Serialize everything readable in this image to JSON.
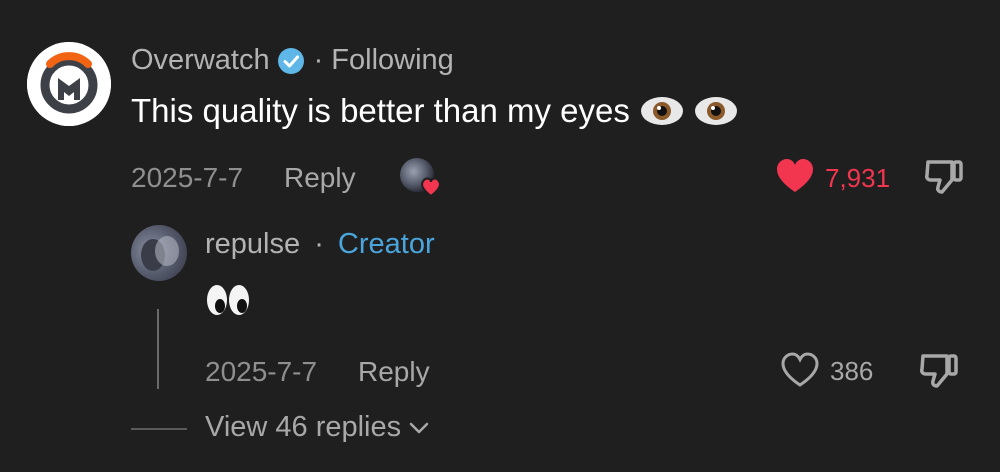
{
  "comment": {
    "author": "Overwatch",
    "separator": "·",
    "following_label": "Following",
    "text": "This quality is better than my eyes",
    "emoji": [
      "eyes-emoji",
      "eyes-emoji"
    ],
    "date": "2025-7-7",
    "reply_label": "Reply",
    "like_count": "7,931",
    "liked": true,
    "icons": {
      "verified": "verified-badge-icon",
      "like": "heart-icon",
      "dislike": "thumbs-down-icon",
      "creator_like": "creator-liked-avatar-icon"
    }
  },
  "reply": {
    "author": "repulse",
    "separator": "·",
    "creator_label": "Creator",
    "text_emoji": "👀",
    "date": "2025-7-7",
    "reply_label": "Reply",
    "like_count": "386",
    "liked": false
  },
  "view_replies": {
    "label": "View 46 replies"
  },
  "colors": {
    "background": "#1f1f1f",
    "like_red": "#f23650",
    "creator_blue": "#4aa5dc",
    "verified_blue": "#5fb7e8",
    "overwatch_orange": "#f06414"
  }
}
